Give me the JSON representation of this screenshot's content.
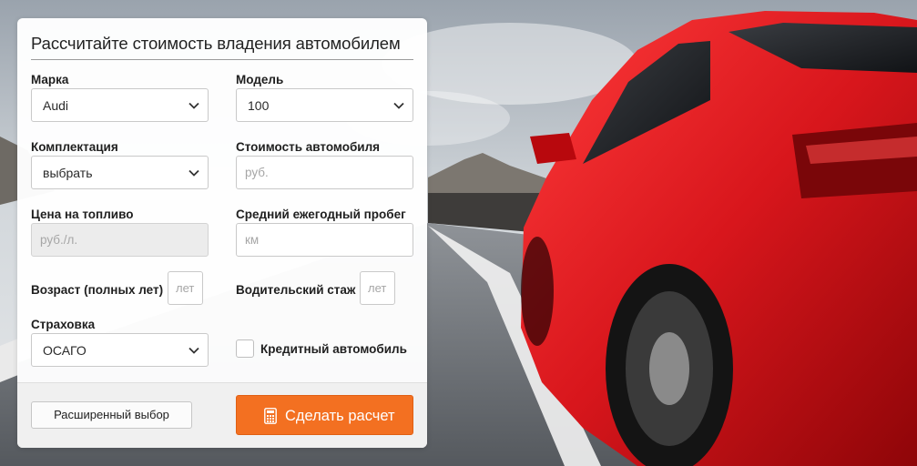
{
  "form": {
    "title": "Рассчитайте стоимость владения автомобилем",
    "brand": {
      "label": "Марка",
      "value": "Audi"
    },
    "model": {
      "label": "Модель",
      "value": "100"
    },
    "trim": {
      "label": "Комплектация",
      "value": "выбрать"
    },
    "car_price": {
      "label": "Стоимость автомобиля",
      "placeholder": "руб."
    },
    "fuel_price": {
      "label": "Цена на топливо",
      "placeholder": "руб./л."
    },
    "annual_mileage": {
      "label": "Средний ежегодный пробег",
      "placeholder": "км"
    },
    "age": {
      "label": "Возраст (полных лет)",
      "placeholder": "лет"
    },
    "driving_experience": {
      "label": "Водительский стаж",
      "placeholder": "лет"
    },
    "insurance": {
      "label": "Страховка",
      "value": "ОСАГО"
    },
    "credit_car": {
      "label": "Кредитный автомобиль",
      "checked": false
    }
  },
  "footer": {
    "advanced_button": "Расширенный выбор",
    "calculate_button": "Сделать расчет",
    "calculate_icon": "calculator-icon"
  },
  "colors": {
    "accent": "#f37021",
    "car": "#d8161c"
  }
}
